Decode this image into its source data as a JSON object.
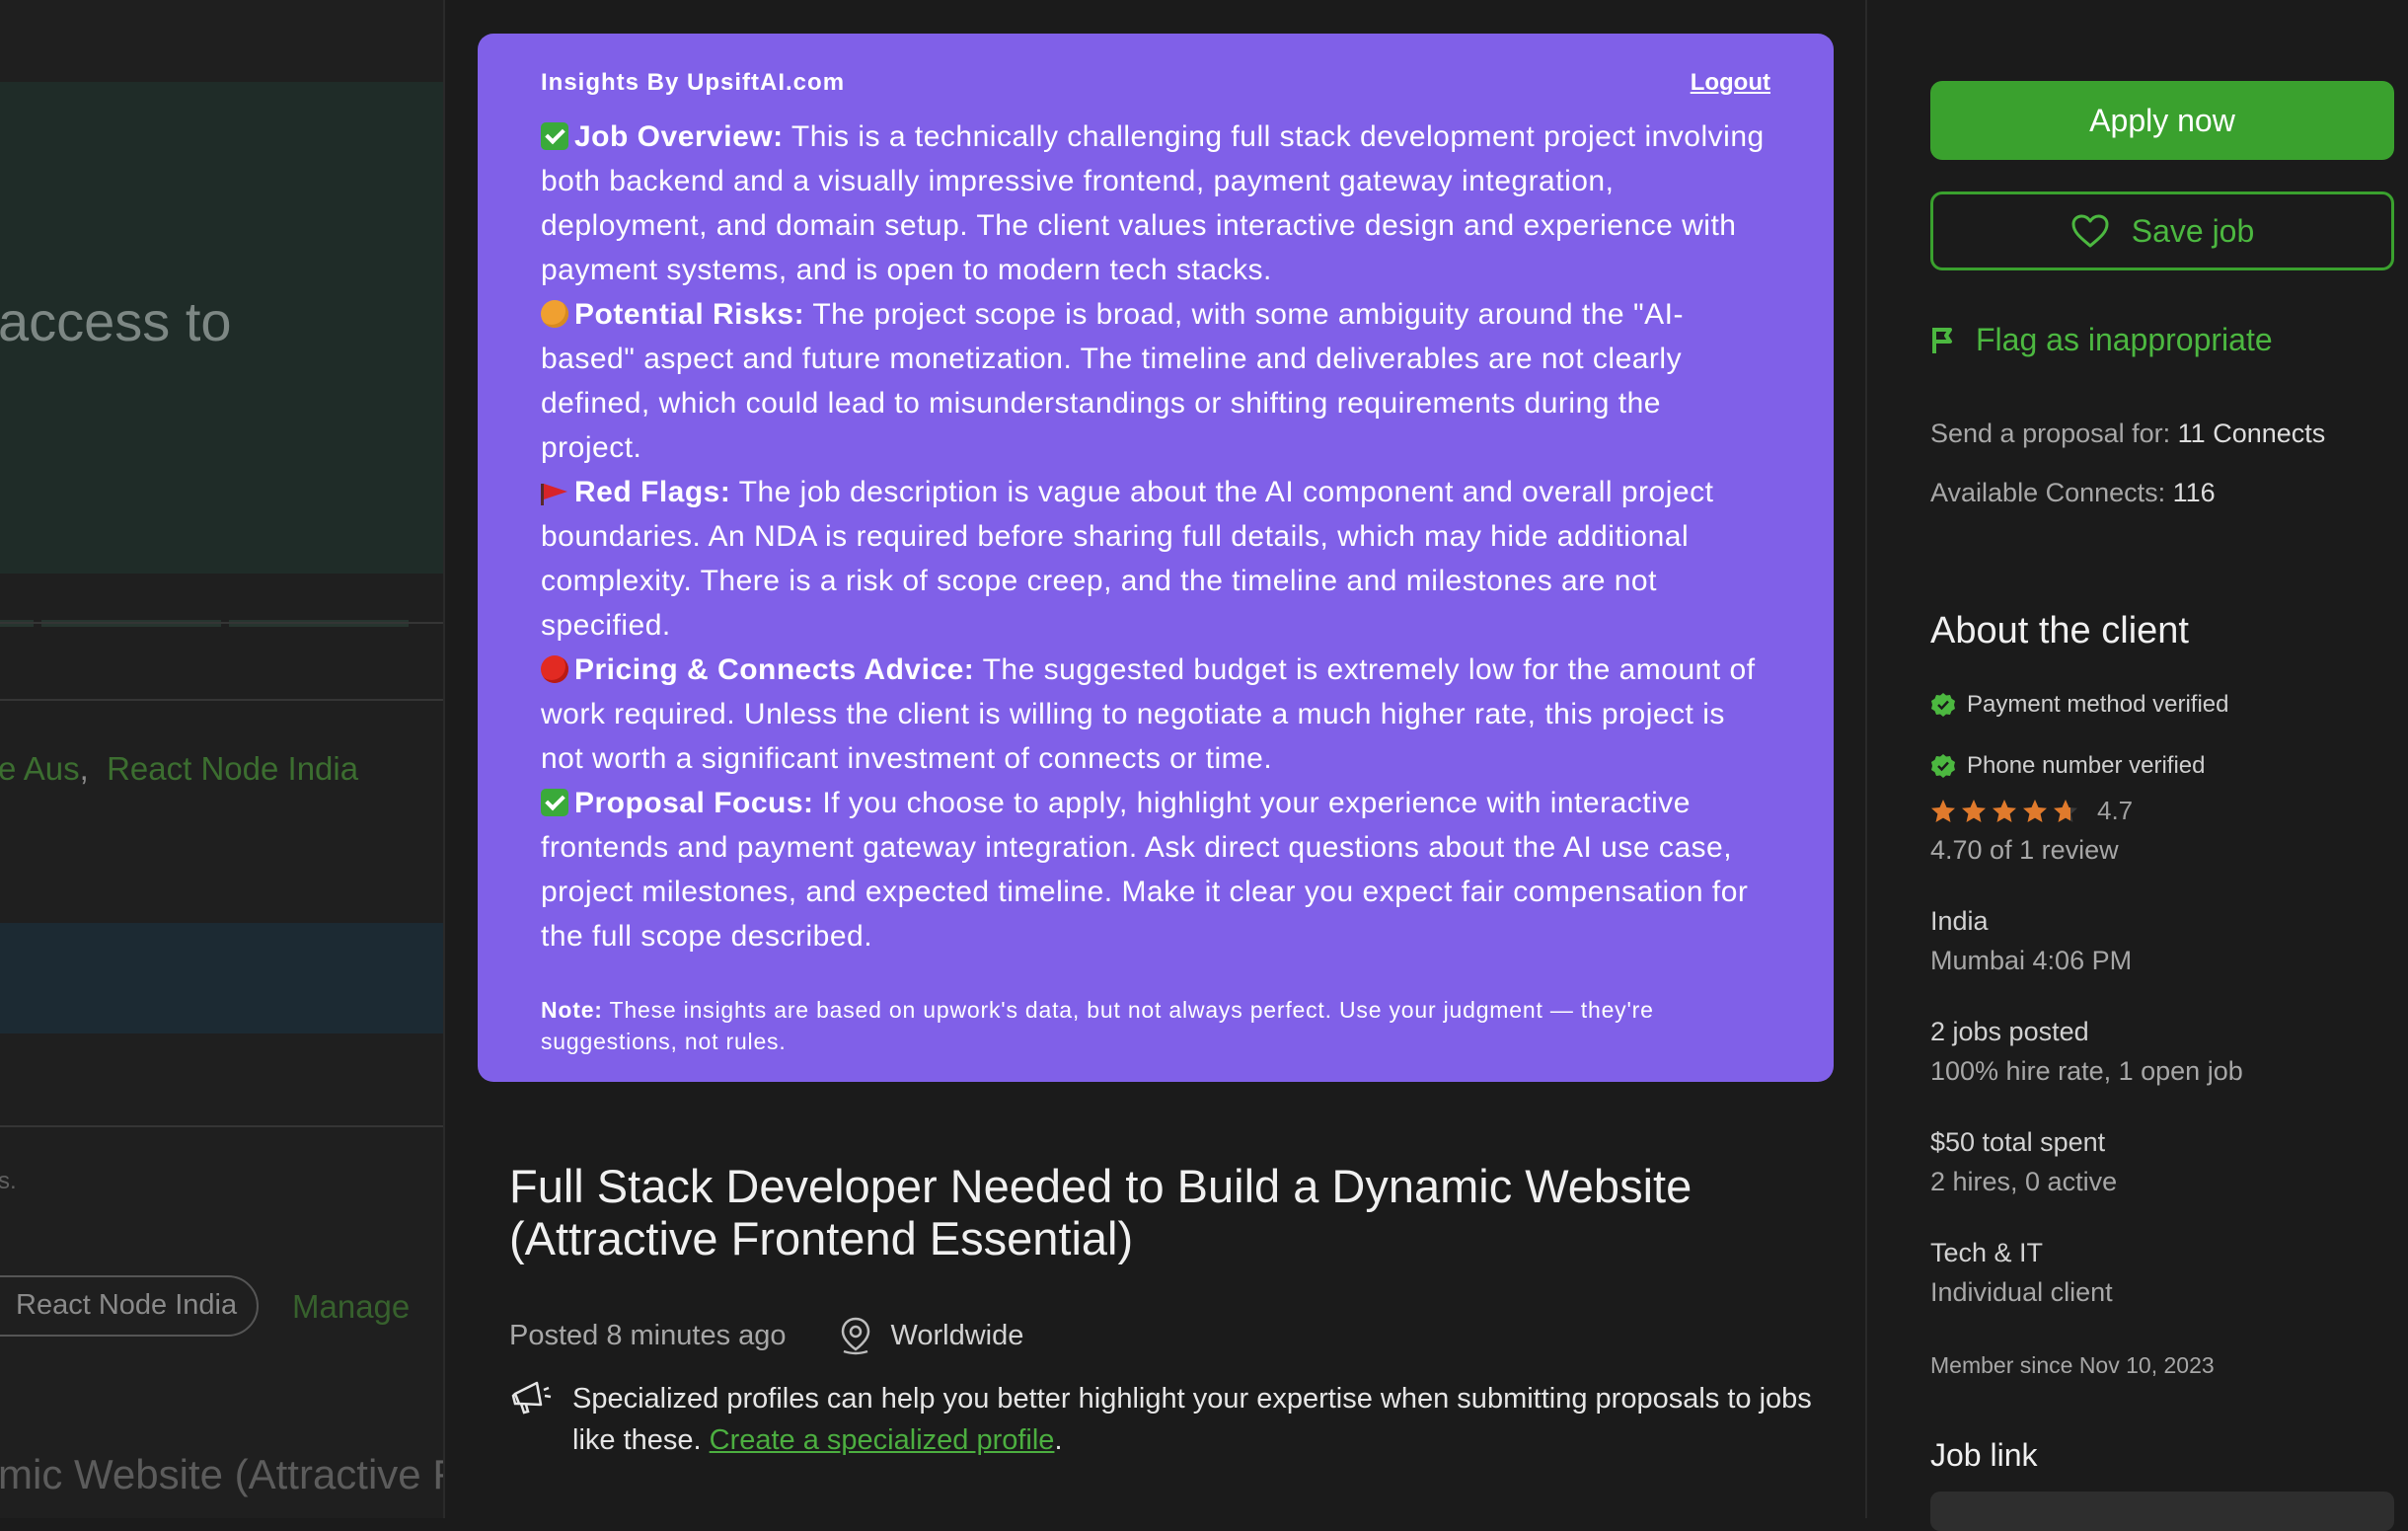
{
  "left_panel": {
    "hero_text": "access to",
    "tags": [
      "e Aus",
      "React Node India"
    ],
    "small_text": "s.",
    "pill": "React Node India",
    "manage": "Manage",
    "bottom_title": "mic Website (Attractive Fr"
  },
  "insights": {
    "brand": "Insights By UpsiftAI.com",
    "logout": "Logout",
    "overview_title": "Job Overview:",
    "overview_text": " This is a technically challenging full stack development project involving both backend and a visually impressive frontend, payment gateway integration, deployment, and domain setup. The client values interactive design and experience with payment systems, and is open to modern tech stacks.",
    "risks_title": "Potential Risks:",
    "risks_text": " The project scope is broad, with some ambiguity around the \"AI-based\" aspect and future monetization. The timeline and deliverables are not clearly defined, which could lead to misunderstandings or shifting requirements during the project.",
    "redflags_title": "Red Flags:",
    "redflags_text": " The job description is vague about the AI component and overall project boundaries. An NDA is required before sharing full details, which may hide additional complexity. There is a risk of scope creep, and the timeline and milestones are not specified.",
    "pricing_title": "Pricing & Connects Advice:",
    "pricing_text": " The suggested budget is extremely low for the amount of work required. Unless the client is willing to negotiate a much higher rate, this project is not worth a significant investment of connects or time.",
    "focus_title": "Proposal Focus:",
    "focus_text": " If you choose to apply, highlight your experience with interactive frontends and payment gateway integration. Ask direct questions about the AI use case, project milestones, and expected timeline. Make it clear you expect fair compensation for the full scope described.",
    "note_label": "Note:",
    "note_text": " These insights are based on upwork's data, but not always perfect. Use your judgment — they're suggestions, not rules."
  },
  "job": {
    "title": "Full Stack Developer Needed to Build a Dynamic Website (Attractive Frontend Essential)",
    "posted": "Posted 8 minutes ago",
    "location": "Worldwide",
    "spec_text": "Specialized profiles can help you better highlight your expertise when submitting proposals to jobs like these. ",
    "spec_link": "Create a specialized profile",
    "spec_end": "."
  },
  "sidebar": {
    "apply": "Apply now",
    "save": "Save job",
    "flag": "Flag as inappropriate",
    "send_label": "Send a proposal for: ",
    "send_value": "11 Connects",
    "available_label": "Available Connects: ",
    "available_value": "116",
    "about_heading": "About the client",
    "payment_verified": "Payment method verified",
    "phone_verified": "Phone number verified",
    "rating": "4.7",
    "rating_value": 4.7,
    "reviews": "4.70 of 1 review",
    "country": "India",
    "city_time": "Mumbai 4:06 PM",
    "jobs_posted": "2 jobs posted",
    "hire_rate": "100% hire rate, 1 open job",
    "total_spent": "$50 total spent",
    "hires": "2 hires, 0 active",
    "industry": "Tech & IT",
    "client_type": "Individual client",
    "member_since": "Member since Nov 10, 2023",
    "job_link_heading": "Job link"
  },
  "colors": {
    "accent_green": "#3aa12e",
    "insights_purple": "#8060e8",
    "star_orange": "#e07a2c",
    "verified_green": "#4cb840"
  },
  "icons": [
    "check-emoji-icon",
    "orange-circle-icon",
    "red-flag-icon",
    "red-circle-icon",
    "location-pin-icon",
    "megaphone-icon",
    "heart-icon",
    "flag-icon",
    "verified-badge-icon",
    "star-icon"
  ]
}
